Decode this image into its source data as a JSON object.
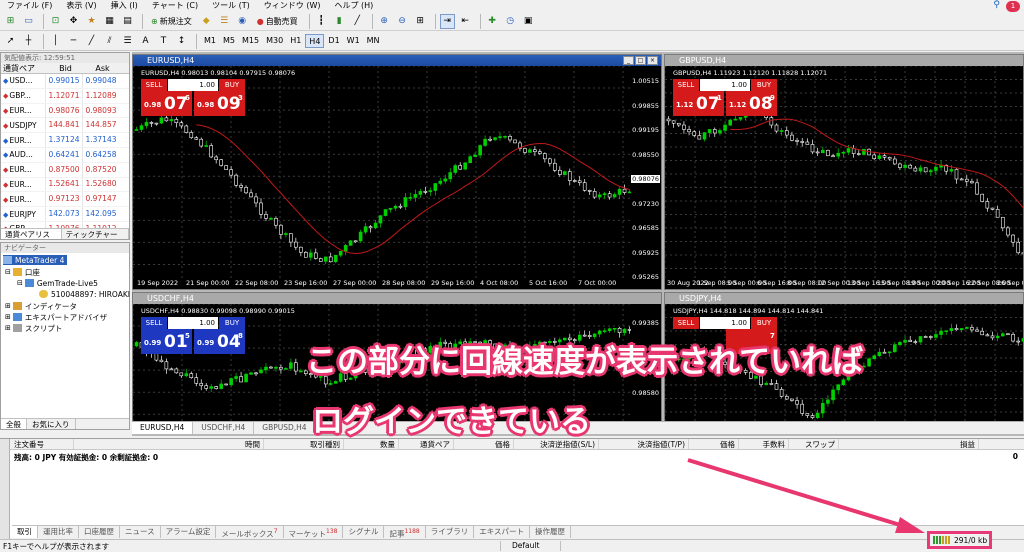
{
  "menu": [
    "ファイル (F)",
    "表示 (V)",
    "挿入 (I)",
    "チャート (C)",
    "ツール (T)",
    "ウィンドウ (W)",
    "ヘルプ (H)"
  ],
  "toolbar": {
    "new_order": "新規注文",
    "auto_trade": "自動売買",
    "timeframes": [
      "M1",
      "M5",
      "M15",
      "M30",
      "H1",
      "H4",
      "D1",
      "W1",
      "MN"
    ],
    "active_timeframe": "H4",
    "notify_count": "1"
  },
  "market_watch": {
    "title": "気配値表示: 12:59:51",
    "headers": [
      "通貨ペア",
      "Bid",
      "Ask"
    ],
    "rows": [
      {
        "symbol": "USD...",
        "bid": "0.99015",
        "ask": "0.99048",
        "dir": "up"
      },
      {
        "symbol": "GBP...",
        "bid": "1.12071",
        "ask": "1.12089",
        "dir": "dn"
      },
      {
        "symbol": "EUR...",
        "bid": "0.98076",
        "ask": "0.98093",
        "dir": "dn"
      },
      {
        "symbol": "USDJPY",
        "bid": "144.841",
        "ask": "144.857",
        "dir": "dn"
      },
      {
        "symbol": "EUR...",
        "bid": "1.37124",
        "ask": "1.37143",
        "dir": "up"
      },
      {
        "symbol": "AUD...",
        "bid": "0.64241",
        "ask": "0.64258",
        "dir": "up"
      },
      {
        "symbol": "EUR...",
        "bid": "0.87500",
        "ask": "0.87520",
        "dir": "dn"
      },
      {
        "symbol": "EUR...",
        "bid": "1.52641",
        "ask": "1.52680",
        "dir": "dn"
      },
      {
        "symbol": "EUR...",
        "bid": "0.97123",
        "ask": "0.97147",
        "dir": "dn"
      },
      {
        "symbol": "EURJPY",
        "bid": "142.073",
        "ask": "142.095",
        "dir": "up"
      },
      {
        "symbol": "GBP...",
        "bid": "1.10976",
        "ask": "1.11012",
        "dir": "dn"
      }
    ],
    "tabs": [
      "通貨ペアリスト",
      "ティックチャート"
    ]
  },
  "navigator": {
    "title": "ナビゲーター",
    "items": [
      "MetaTrader 4",
      "口座",
      "GemTrade-Live5",
      "510048897: HIROAKI",
      "インディケータ",
      "エキスパートアドバイザ",
      "スクリプト"
    ],
    "tabs": [
      "全般",
      "お気に入り"
    ]
  },
  "charts": [
    {
      "title": "EURUSD,H4",
      "info": "EURUSD,H4  0.98013 0.98104 0.97915 0.98076",
      "lot": "1.00",
      "sell": {
        "label": "SELL",
        "small": "0.98",
        "big": "07",
        "sup": "6"
      },
      "buy": {
        "label": "BUY",
        "small": "0.98",
        "big": "09",
        "sup": "3"
      },
      "yticks": [
        "1.00515",
        "0.99855",
        "0.99195",
        "0.98550",
        "0.98076",
        "0.97230",
        "0.96585",
        "0.95925",
        "0.95265"
      ],
      "xticks": [
        "19 Sep 2022",
        "21 Sep 00:00",
        "22 Sep 08:00",
        "23 Sep 16:00",
        "27 Sep 00:00",
        "28 Sep 08:00",
        "29 Sep 16:00",
        "4 Oct 08:00",
        "5 Oct 16:00",
        "7 Oct 00:00"
      ],
      "current": "0.98076",
      "active": true
    },
    {
      "title": "GBPUSD,H4",
      "info": "GBPUSD,H4  1.11923 1.12120 1.11828 1.12071",
      "lot": "1.00",
      "sell": {
        "label": "SELL",
        "small": "1.12",
        "big": "07",
        "sup": "1"
      },
      "buy": {
        "label": "BUY",
        "small": "1.12",
        "big": "08",
        "sup": "9"
      },
      "xticks": [
        "30 Aug 2022",
        "1 Sep 08:00",
        "5 Sep 00:00",
        "6 Sep 16:00",
        "8 Sep 08:00",
        "12 Sep 00:00",
        "13 Sep 16:00",
        "15 Sep 08:00",
        "19 Sep 00:00",
        "20 Sep 16:00",
        "22 Sep 08:00",
        "26 Sep 00:00"
      ],
      "active": false
    },
    {
      "title": "USDCHF,H4",
      "info": "USDCHF,H4  0.98830 0.99098 0.98990 0.99015",
      "lot": "1.00",
      "sell": {
        "label": "SELL",
        "small": "0.99",
        "big": "01",
        "sup": "5"
      },
      "buy": {
        "label": "BUY",
        "small": "0.99",
        "big": "04",
        "sup": "8"
      },
      "yticks": [
        "0.99385",
        "0.98580"
      ],
      "active": false
    },
    {
      "title": "USDJPY,H4",
      "info": "USDJPY,H4  144.818 144.894 144.814 144.841",
      "lot": "1.00",
      "sell": {
        "label": "SELL",
        "small": "",
        "big": "",
        "sup": ""
      },
      "buy": {
        "label": "BUY",
        "small": "",
        "big": "",
        "sup": "7"
      },
      "active": false
    }
  ],
  "chart_tabs": [
    "EURUSD,H4",
    "USDCHF,H4",
    "GBPUSD,H4"
  ],
  "terminal": {
    "headers": [
      "注文番号",
      "時間",
      "取引種別",
      "数量",
      "通貨ペア",
      "価格",
      "決済逆指値(S/L)",
      "決済指値(T/P)",
      "価格",
      "手数料",
      "スワップ",
      "損益"
    ],
    "balance_line": "残高: 0 JPY  有効証拠金: 0  余剰証拠金: 0",
    "profit": "0",
    "tabs": [
      {
        "label": "取引",
        "badge": ""
      },
      {
        "label": "運用比率",
        "badge": ""
      },
      {
        "label": "口座履歴",
        "badge": ""
      },
      {
        "label": "ニュース",
        "badge": ""
      },
      {
        "label": "アラーム設定",
        "badge": ""
      },
      {
        "label": "メールボックス",
        "badge": "7"
      },
      {
        "label": "マーケット",
        "badge": "138"
      },
      {
        "label": "シグナル",
        "badge": ""
      },
      {
        "label": "記事",
        "badge": "1188"
      },
      {
        "label": "ライブラリ",
        "badge": ""
      },
      {
        "label": "エキスパート",
        "badge": ""
      },
      {
        "label": "操作履歴",
        "badge": ""
      }
    ]
  },
  "status": {
    "help": "F1キーでヘルプが表示されます",
    "profile": "Default",
    "connection": "291/0 kb"
  },
  "annotation": {
    "line1": "この部分に回線速度が表示されていれば",
    "line2": "ログインできている",
    "color": "#e8366f"
  },
  "colors": {
    "bull_candle": "#00d000",
    "bear_candle": "#ffffff",
    "ma_line": "#c01818",
    "sell": "#d41a1a",
    "buy_blue": "#1e38c0"
  }
}
